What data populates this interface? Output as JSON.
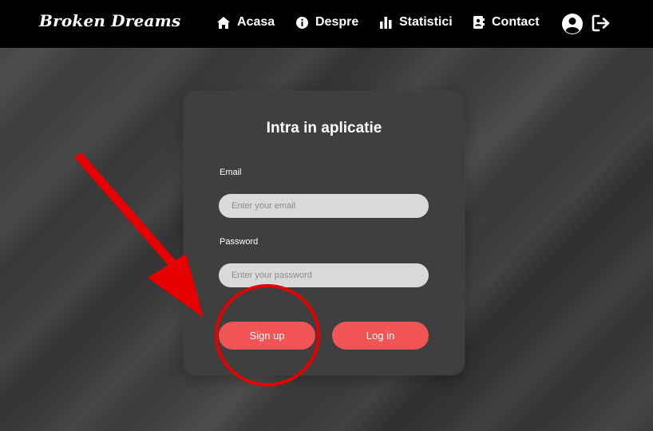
{
  "header": {
    "brand": "Broken Dreams",
    "nav": [
      {
        "label": "Acasa",
        "icon": "home-icon"
      },
      {
        "label": "Despre",
        "icon": "info-icon"
      },
      {
        "label": "Statistici",
        "icon": "bar-chart-icon"
      },
      {
        "label": "Contact",
        "icon": "contact-card-icon"
      }
    ],
    "actions": [
      {
        "icon": "user-icon"
      },
      {
        "icon": "logout-icon"
      }
    ]
  },
  "login": {
    "title": "Intra in aplicatie",
    "email_label": "Email",
    "email_placeholder": "Enter your email",
    "password_label": "Password",
    "password_placeholder": "Enter your password",
    "signup_label": "Sign up",
    "login_label": "Log in"
  },
  "colors": {
    "header_bg": "#000000",
    "card_bg": "#3f3f3f",
    "button": "#f15454",
    "input_bg": "#d9d9d9",
    "annotation": "#e60000"
  }
}
